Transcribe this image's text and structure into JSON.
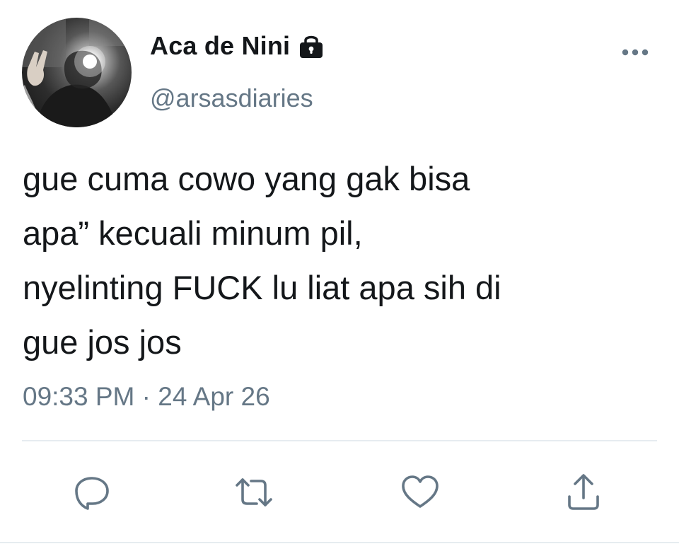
{
  "author": {
    "display_name": "Aca de Nini",
    "handle": "@arsasdiaries",
    "avatar_icon": "profile-photo",
    "protected_icon": "lock-icon"
  },
  "tweet": {
    "text": "gue cuma cowo yang gak bisa\napa” kecuali minum pil,\nnyelinting FUCK lu liat apa sih di\ngue jos jos",
    "time": "09:33 PM",
    "separator": "·",
    "date": "24 Apr 26"
  },
  "actions": {
    "more_icon": "more-icon",
    "reply_icon": "reply-icon",
    "retweet_icon": "retweet-icon",
    "like_icon": "heart-icon",
    "share_icon": "share-icon"
  },
  "colors": {
    "text": "#14171a",
    "secondary": "#657786",
    "divider": "#e6ecf0"
  }
}
